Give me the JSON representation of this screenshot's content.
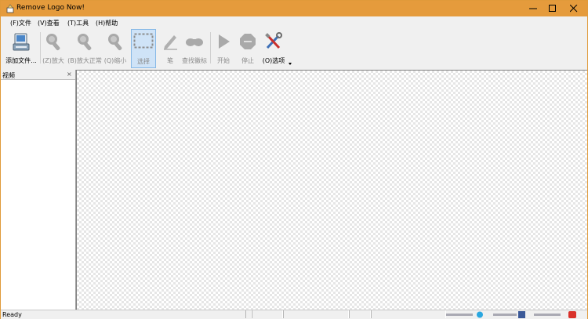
{
  "window": {
    "title": "Remove Logo Now!"
  },
  "menu": [
    {
      "label": "(F)文件"
    },
    {
      "label": "(V)查看"
    },
    {
      "label": "(T)工具"
    },
    {
      "label": "(H)帮助"
    }
  ],
  "toolbar": [
    {
      "label": "添加文件...",
      "icon": "add-file-icon"
    },
    {
      "label": "(Z)放大",
      "icon": "zoom-in-icon"
    },
    {
      "label": "(B)放大正常",
      "icon": "zoom-normal-icon"
    },
    {
      "label": "(Q)缩小",
      "icon": "zoom-out-icon"
    },
    {
      "label": "选择",
      "icon": "select-rect-icon"
    },
    {
      "label": "笔",
      "icon": "pen-icon"
    },
    {
      "label": "查找徽标",
      "icon": "find-logo-icon"
    },
    {
      "label": "开始",
      "icon": "play-icon"
    },
    {
      "label": "停止",
      "icon": "stop-icon"
    },
    {
      "label": "(O)选项",
      "icon": "options-tools-icon"
    }
  ],
  "left_pane": {
    "title": "视频",
    "close": "×"
  },
  "status": {
    "text": "Ready"
  },
  "colors": {
    "title_bar": "#e59b3c",
    "active_tool": "#cfe3f7",
    "disabled_text": "#8a8a8a"
  }
}
